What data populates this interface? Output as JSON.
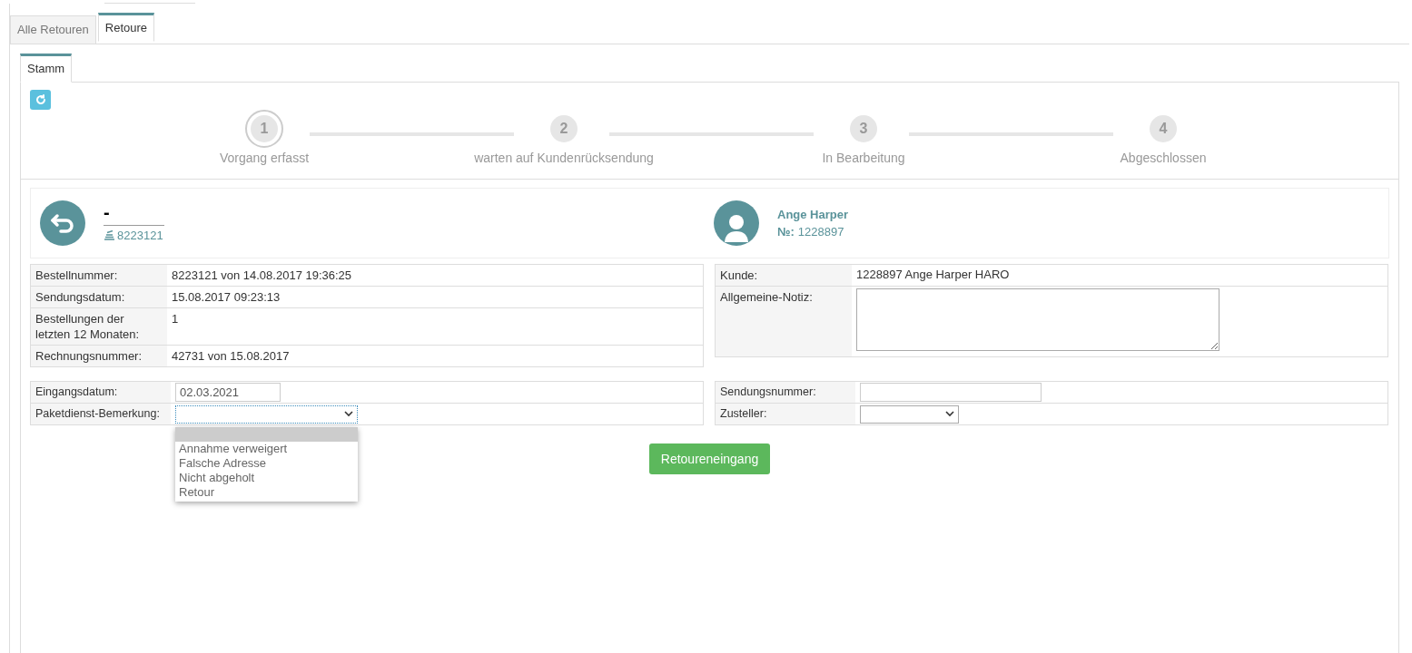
{
  "tabs": [
    {
      "label": "Alle Retouren",
      "selected": false
    },
    {
      "label": "Retoure",
      "selected": true
    }
  ],
  "subtabs": [
    {
      "label": "Stamm",
      "selected": true
    }
  ],
  "steps": [
    {
      "number": "1",
      "label": "Vorgang erfasst",
      "selected": true
    },
    {
      "number": "2",
      "label": "warten auf Kundenrücksendung",
      "selected": false
    },
    {
      "number": "3",
      "label": "In Bearbeitung",
      "selected": false
    },
    {
      "number": "4",
      "label": "Abgeschlossen",
      "selected": false
    }
  ],
  "header": {
    "title": "-",
    "order_number": "8223121",
    "customer_name": "Ange Harper",
    "customer_no_label": "№:",
    "customer_no": "1228897"
  },
  "order_details": [
    {
      "label": "Bestellnummer:",
      "value": "8223121 von 14.08.2017 19:36:25"
    },
    {
      "label": "Sendungsdatum:",
      "value": "15.08.2017 09:23:13"
    },
    {
      "label": "Bestellungen der letzten 12 Monaten:",
      "value": "1"
    },
    {
      "label": "Rechnungsnummer:",
      "value": "42731 von 15.08.2017"
    }
  ],
  "customer_details": [
    {
      "kind": "text",
      "label": "Kunde:",
      "value": "1228897 Ange Harper HARO"
    },
    {
      "kind": "textarea",
      "label": "Allgemeine-Notiz:"
    }
  ],
  "form_left": [
    {
      "kind": "input",
      "label": "Eingangsdatum:",
      "value": "02.03.2021"
    },
    {
      "kind": "select",
      "label": "Paketdienst-Bemerkung:",
      "open": true,
      "blank_highlighted": true,
      "options": [
        {
          "label": "Annahme verweigert",
          "selected": false
        },
        {
          "label": "Falsche Adresse",
          "selected": false
        },
        {
          "label": "Nicht abgeholt",
          "selected": false
        },
        {
          "label": "Retour",
          "selected": false
        }
      ]
    }
  ],
  "form_right": [
    {
      "kind": "input",
      "label": "Sendungsnummer:"
    },
    {
      "kind": "select",
      "label": "Zusteller:",
      "open": false
    }
  ],
  "button": "Retoureneingang"
}
